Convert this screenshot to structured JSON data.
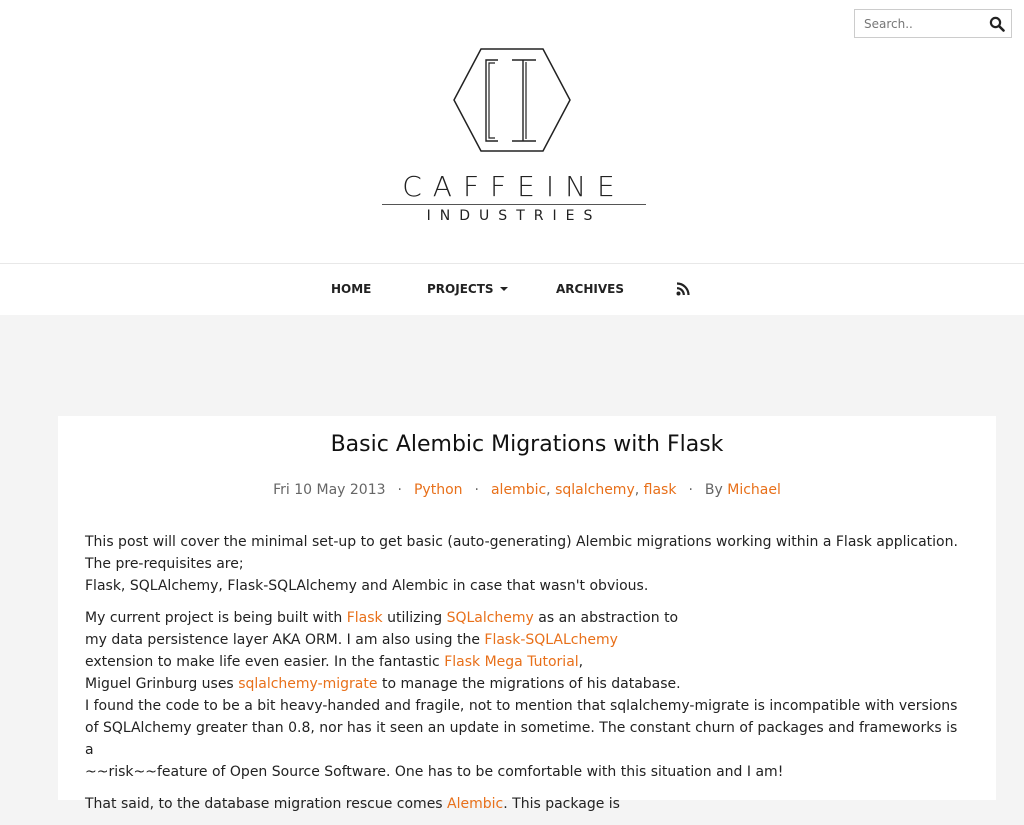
{
  "search": {
    "placeholder": "Search.."
  },
  "logo": {
    "word": "CAFFEINE",
    "sub": "INDUSTRIES"
  },
  "nav": {
    "home": "HOME",
    "projects": "PROJECTS",
    "archives": "ARCHIVES"
  },
  "post": {
    "title": "Basic Alembic Migrations with Flask",
    "meta": {
      "date": "Fri 10 May 2013",
      "category": "Python",
      "tags": [
        "alembic",
        "sqlalchemy",
        "flask"
      ],
      "by_label": "By",
      "author": "Michael"
    },
    "p1": [
      "This post will cover the minimal set-up to get basic (auto-generating) Alembic migrations working within a Flask application. The pre-requisites are;",
      "Flask, SQLAlchemy, Flask-SQLAlchemy and Alembic in case that wasn't obvious."
    ],
    "p2": {
      "t1": "My current project is being built with ",
      "l1": "Flask",
      "t2": " utilizing ",
      "l2": "SQLalchemy",
      "t3": " as an abstraction to",
      "t4": "my data persistence layer AKA ORM. I am also using the ",
      "l3": "Flask-SQLALchemy",
      "t5": "extension to make life even easier. In the fantastic ",
      "l4": "Flask Mega Tutorial",
      "t6": ",",
      "t7": "Miguel Grinburg uses ",
      "l5": "sqlalchemy-migrate",
      "t8": " to manage the migrations of his database.",
      "t9": "I found the code to be a bit heavy-handed and fragile, not to mention that sqlalchemy-migrate is incompatible with versions",
      "t10": "of SQLAlchemy greater than 0.8, nor has it seen an update in sometime. The constant churn of packages and frameworks is a",
      "t11": "~~risk~~feature of Open Source Software. One has to be comfortable with this situation and I am!"
    },
    "p3": {
      "t1": "That said, to the database migration rescue comes ",
      "l1": "Alembic",
      "t2": ". This package is"
    }
  },
  "colors": {
    "accent": "#e8701a",
    "page_bg": "#f4f4f4"
  },
  "icons": {
    "search": "magnifier-icon",
    "rss": "rss-icon",
    "logo": "hexagon-ci-logo"
  }
}
